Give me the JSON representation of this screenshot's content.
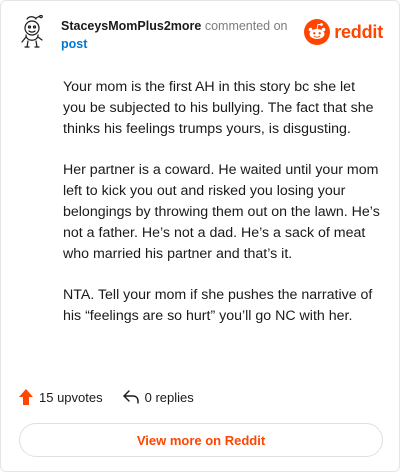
{
  "header": {
    "username": "StaceysMomPlus2more",
    "action": "commented on",
    "post_link": "post",
    "brand": "reddit"
  },
  "comment": {
    "paragraphs": [
      "Your mom is the first AH in this story bc she let you be subjected to his bullying. The fact that she thinks his feelings trumps yours, is disgusting.",
      "Her partner is a coward. He waited until your mom left to kick you out and risked you losing your belongings by throwing them out on the lawn. He’s not a father. He’s not a dad. He’s a sack of meat who married his partner and that’s it.",
      "NTA. Tell your mom if she pushes the narrative of his “feelings are so hurt” you’ll go NC with her."
    ]
  },
  "footer": {
    "upvotes": "15 upvotes",
    "replies": "0 replies",
    "view_more": "View more on Reddit"
  },
  "colors": {
    "accent": "#ff4500",
    "link": "#0079d3",
    "muted": "#7c7c7c"
  },
  "icons": [
    "avatar-snoo-icon",
    "reddit-logo-icon",
    "upvote-arrow-icon",
    "reply-icon"
  ]
}
